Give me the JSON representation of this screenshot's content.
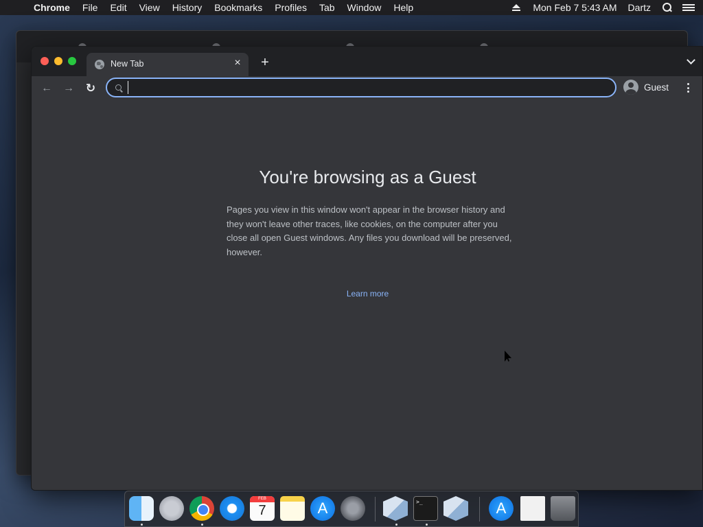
{
  "menubar": {
    "apple": "",
    "app_name": "Chrome",
    "items": [
      "File",
      "Edit",
      "View",
      "History",
      "Bookmarks",
      "Profiles",
      "Tab",
      "Window",
      "Help"
    ],
    "datetime": "Mon Feb 7  5:43 AM",
    "user": "Dartz"
  },
  "browser": {
    "tab": {
      "title": "New Tab",
      "close": "×"
    },
    "new_tab": "+",
    "toolbar": {
      "back": "←",
      "forward": "→",
      "reload": "↻",
      "omnibox_value": "",
      "profile_label": "Guest"
    }
  },
  "page": {
    "title": "You're browsing as a Guest",
    "body": "Pages you view in this window won't appear in the browser history and they won't leave other traces, like cookies, on the computer after you close all open Guest windows. Any files you download will be preserved, however.",
    "learn_more": "Learn more"
  },
  "dock": {
    "calendar_month": "FEB",
    "calendar_day": "7",
    "appstore_glyph": "A",
    "terminal_prompt": ">_"
  },
  "colors": {
    "accent": "#8ab4f8",
    "window_bg": "#35363a",
    "tabstrip_bg": "#202124"
  }
}
